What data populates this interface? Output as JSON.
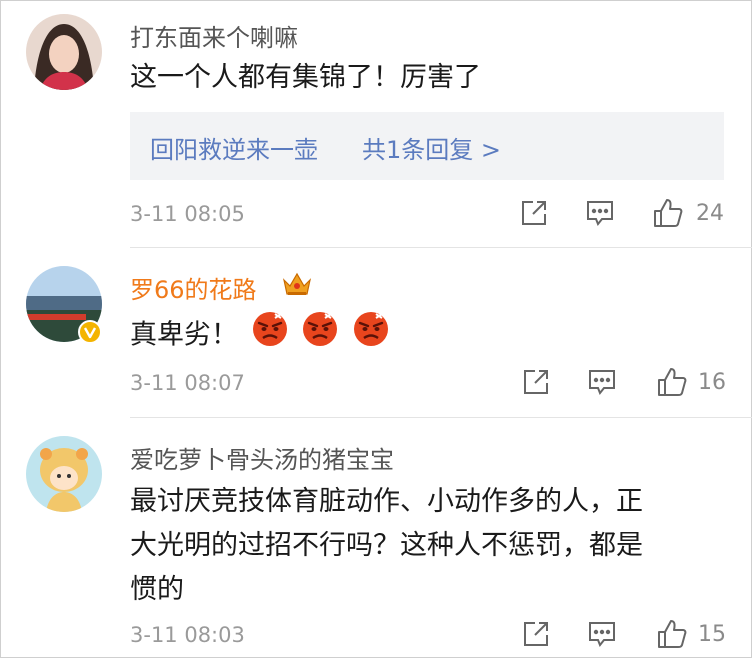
{
  "comments": [
    {
      "username": "打东面来个喇嘛",
      "content": "这一个人都有集锦了！厉害了",
      "reply_link": "回阳救逆来一壶",
      "reply_count": "共1条回复 >",
      "time": "3-11 08:05",
      "likes": "24"
    },
    {
      "username": "罗66的花路",
      "content": "真卑劣！",
      "time": "3-11 08:07",
      "likes": "16"
    },
    {
      "username": "爱吃萝卜骨头汤的猪宝宝",
      "content_lines": [
        "最讨厌竞技体育脏动作、小动作多的人，正",
        "大光明的过招不行吗？这种人不惩罚，都是",
        "惯的"
      ],
      "time": "3-11 08:03",
      "likes": "15"
    }
  ],
  "icons": [
    "share-icon",
    "comment-icon",
    "like-icon",
    "crown-icon",
    "verified-icon",
    "angry-emoji-icon"
  ],
  "colors": {
    "vip_name": "#f07a1a",
    "link": "#5b7bbf",
    "verified": "#f4b400",
    "emoji": "#e8451d"
  }
}
